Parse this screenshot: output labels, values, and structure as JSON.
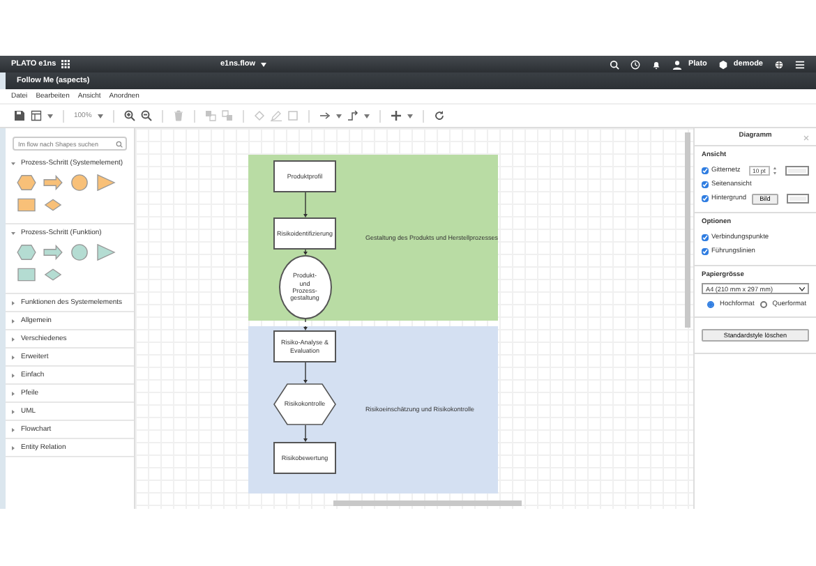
{
  "app_bar": {
    "brand": "PLATO e1ns",
    "app_menu": "e1ns.flow",
    "user": "Plato",
    "workspace": "demode"
  },
  "document": {
    "title": "Follow Me (aspects)"
  },
  "menu": [
    "Datei",
    "Bearbeiten",
    "Ansicht",
    "Anordnen"
  ],
  "toolbar": {
    "zoom": "100%"
  },
  "sidebar": {
    "search": {
      "placeholder": "Im flow nach Shapes suchen"
    },
    "groups": [
      {
        "label": "Prozess-Schritt (Systemelement)",
        "expanded": true,
        "color": "#f8c078",
        "shapes": [
          {
            "kind": "hexagon"
          },
          {
            "kind": "arrow"
          },
          {
            "kind": "circle"
          },
          {
            "kind": "triangle"
          },
          {
            "kind": "rectangle"
          },
          {
            "kind": "diamond"
          }
        ]
      },
      {
        "label": "Prozess-Schritt (Funktion)",
        "expanded": true,
        "color": "#b4dcd2",
        "shapes": [
          {
            "kind": "hexagon"
          },
          {
            "kind": "arrow"
          },
          {
            "kind": "circle"
          },
          {
            "kind": "triangle"
          },
          {
            "kind": "rectangle"
          },
          {
            "kind": "diamond"
          }
        ]
      },
      {
        "label": "Funktionen des Systemelements",
        "expanded": false
      },
      {
        "label": "Allgemein",
        "expanded": false
      },
      {
        "label": "Verschiedenes",
        "expanded": false
      },
      {
        "label": "Erweitert",
        "expanded": false
      },
      {
        "label": "Einfach",
        "expanded": false
      },
      {
        "label": "Pfeile",
        "expanded": false
      },
      {
        "label": "UML",
        "expanded": false
      },
      {
        "label": "Flowchart",
        "expanded": false
      },
      {
        "label": "Entity Relation",
        "expanded": false
      }
    ]
  },
  "diagram": {
    "lanes": [
      {
        "label": "Gestaltung des Produkts und Herstellprozesses",
        "color": "#b9dca4",
        "nodes": [
          {
            "kind": "process",
            "label": "Produktprofil"
          },
          {
            "kind": "process",
            "label": "Risikoidentifizierung"
          },
          {
            "kind": "circle",
            "label": "Produkt- und Prozess-gestaltung"
          }
        ]
      },
      {
        "label": "Risikoeinschätzung und Risikokontrolle",
        "color": "#d4e0f2",
        "nodes": [
          {
            "kind": "process",
            "label": "Risiko-Analyse & Evaluation"
          },
          {
            "kind": "hexagon",
            "label": "Risikokontrolle"
          },
          {
            "kind": "process",
            "label": "Risikobewertung"
          }
        ]
      }
    ]
  },
  "format_panel": {
    "title": "Diagramm",
    "sections": [
      {
        "title": "Ansicht",
        "options": [
          {
            "label": "Gitternetz",
            "checked": true,
            "kind": "grid",
            "value": "10 pt"
          },
          {
            "label": "Seitenansicht",
            "checked": true,
            "kind": "plain"
          },
          {
            "label": "Hintergrund",
            "checked": true,
            "kind": "background",
            "button": "Bild"
          }
        ]
      },
      {
        "title": "Optionen",
        "options": [
          {
            "label": "Verbindungspunkte",
            "checked": true,
            "kind": "plain"
          },
          {
            "label": "Führungslinien",
            "checked": true,
            "kind": "plain"
          }
        ]
      }
    ],
    "paper": {
      "title": "Papiergrösse",
      "size": "A4 (210 mm x 297 mm)",
      "orientations": [
        {
          "label": "Hochformat",
          "selected": true
        },
        {
          "label": "Querformat",
          "selected": false
        }
      ]
    },
    "reset_button": "Standardstyle löschen"
  }
}
